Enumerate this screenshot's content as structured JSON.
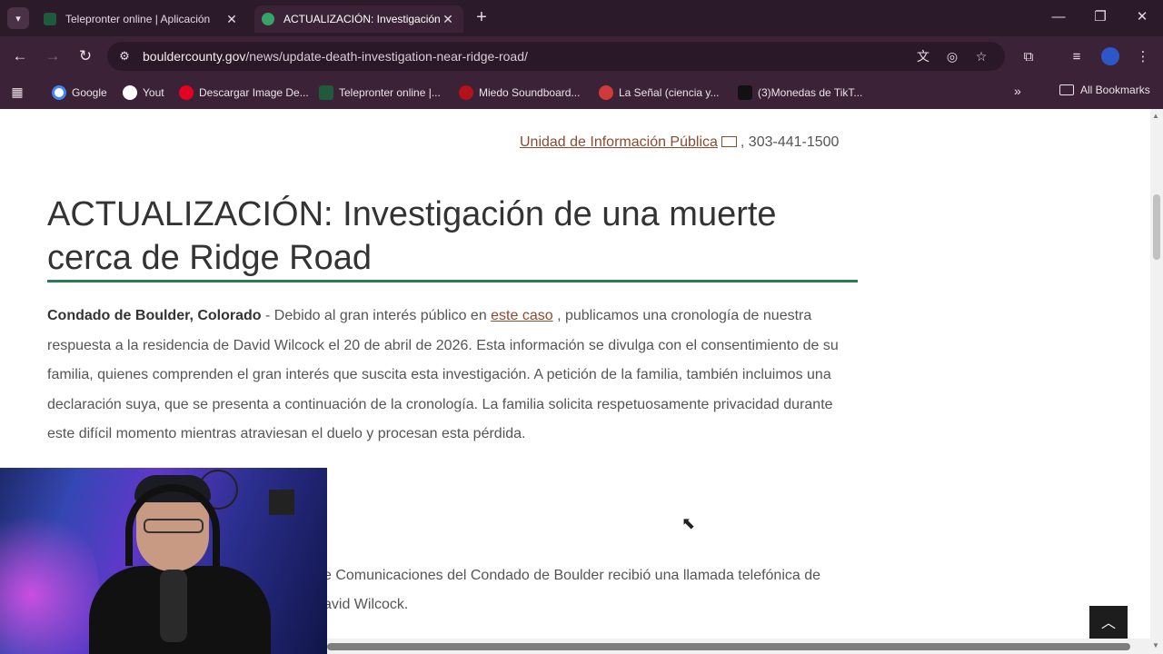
{
  "browser": {
    "tabs": [
      {
        "title": "Telepronter online | Aplicación",
        "favicon_color": "#1f5a3c",
        "active": false
      },
      {
        "title": "ACTUALIZACIÓN: Investigación",
        "favicon_color": "#36a269",
        "active": true
      }
    ],
    "url_host": "bouldercounty.gov",
    "url_path": "/news/update-death-investigation-near-ridge-road/",
    "bookmarks": [
      {
        "label": "Google",
        "icon": "google-icon",
        "color": "#ffffff"
      },
      {
        "label": "Yout",
        "icon": "youtube-icon",
        "color": "#ffffff"
      },
      {
        "label": "Descargar Image De...",
        "icon": "pinterest-icon",
        "color": "#e60023"
      },
      {
        "label": "Telepronter online |...",
        "icon": "teleprompter-icon",
        "color": "#1f5a3c"
      },
      {
        "label": "Miedo Soundboard...",
        "icon": "soundboard-icon",
        "color": "#b3121b"
      },
      {
        "label": "La Señal (ciencia y...",
        "icon": "signal-icon",
        "color": "#d03a3a"
      },
      {
        "label": "(3)Monedas de TikT...",
        "icon": "tiktok-icon",
        "color": "#111111"
      }
    ],
    "all_bookmarks_label": "All Bookmarks"
  },
  "page": {
    "contact_link": "Unidad de Información Pública",
    "contact_phone": ", 303-441-1500",
    "headline": "ACTUALIZACIÓN: Investigación de una muerte cerca de Ridge Road",
    "lead_bold": "Condado de Boulder, Colorado",
    "lead_text_1": " - Debido al gran interés público en ",
    "lead_link": "este caso",
    "lead_text_2": " , publicamos una cronología de nuestra respuesta a la residencia de David Wilcock el 20 de abril de 2026. Esta información se divulga con el consentimiento de su familia, quienes comprenden el gran interés que suscita esta investigación. A petición de la familia, también incluimos una declaración suya, que se presenta a continuación de la cronología. La familia solicita respetuosamente privacidad durante este difícil momento mientras atraviesan el duelo y procesan esta pérdida.",
    "partial_line_1": "e Comunicaciones del Condado de Boulder recibió una llamada telefónica de",
    "partial_line_2": "avid Wilcock.",
    "accent_color": "#2b7a55",
    "link_color": "#8a4b2f"
  }
}
